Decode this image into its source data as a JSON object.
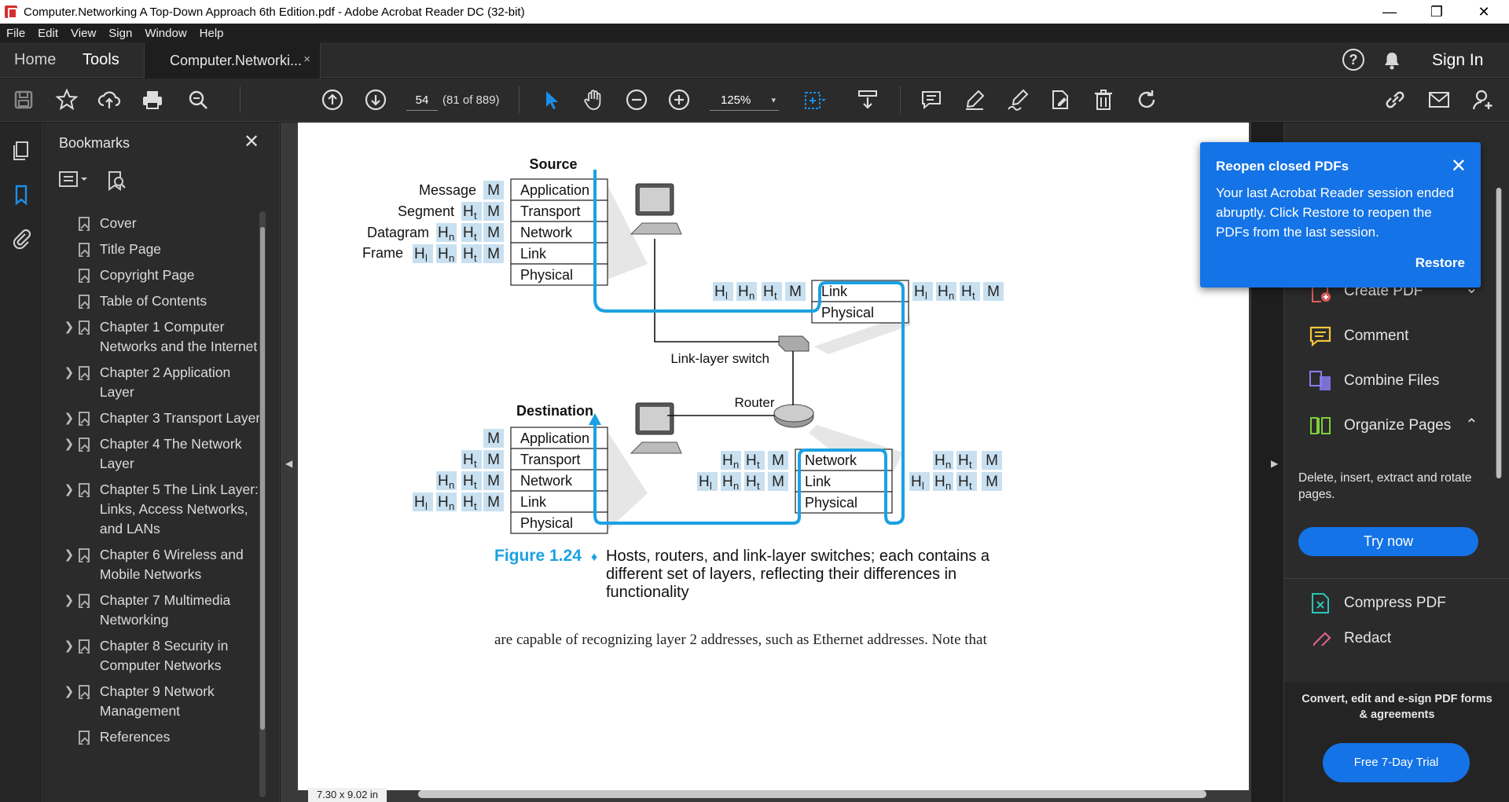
{
  "window": {
    "title": "Computer.Networking A Top-Down Approach 6th Edition.pdf - Adobe Acrobat Reader DC (32-bit)",
    "minimize": "—",
    "maximize": "❐",
    "close": "✕"
  },
  "menu": [
    "File",
    "Edit",
    "View",
    "Sign",
    "Window",
    "Help"
  ],
  "tabs": {
    "home": "Home",
    "tools": "Tools",
    "document": "Computer.Networki...",
    "close": "×"
  },
  "header": {
    "help": "?",
    "sign_in": "Sign In"
  },
  "toolbar": {
    "page_number": "54",
    "page_count": "(81 of 889)",
    "zoom": "125%",
    "zoom_caret": "▾"
  },
  "bookmarks": {
    "title": "Bookmarks",
    "close": "✕",
    "items": [
      {
        "label": "Cover",
        "expandable": false
      },
      {
        "label": "Title Page",
        "expandable": false
      },
      {
        "label": "Copyright Page",
        "expandable": false
      },
      {
        "label": "Table of Contents",
        "expandable": false
      },
      {
        "label": "Chapter 1 Computer Networks and the Internet",
        "expandable": true
      },
      {
        "label": "Chapter 2 Application Layer",
        "expandable": true
      },
      {
        "label": "Chapter 3 Transport Layer",
        "expandable": true
      },
      {
        "label": "Chapter 4 The Network Layer",
        "expandable": true
      },
      {
        "label": "Chapter 5 The Link Layer: Links, Access Networks, and LANs",
        "expandable": true
      },
      {
        "label": "Chapter 6 Wireless and Mobile Networks",
        "expandable": true
      },
      {
        "label": "Chapter 7 Multimedia Networking",
        "expandable": true
      },
      {
        "label": "Chapter 8 Security in Computer Networks",
        "expandable": true
      },
      {
        "label": "Chapter 9 Network Management",
        "expandable": true
      },
      {
        "label": "References",
        "expandable": false
      }
    ]
  },
  "document": {
    "figure": {
      "source": "Source",
      "destination": "Destination",
      "link_layer_switch": "Link-layer switch",
      "router": "Router",
      "row_labels": [
        "Message",
        "Segment",
        "Datagram",
        "Frame"
      ],
      "layers": [
        "Application",
        "Transport",
        "Network",
        "Link",
        "Physical"
      ],
      "switch_layers": [
        "Link",
        "Physical"
      ],
      "router_layers": [
        "Network",
        "Link",
        "Physical"
      ],
      "header_m": "M",
      "header_t": "t",
      "header_n": "n",
      "header_l": "l",
      "header_h": "H",
      "caption_label": "Figure 1.24",
      "caption_diamond": "♦",
      "caption_text": [
        "Hosts, routers, and link-layer switches; each contains a",
        "different set of layers, reflecting their differences in",
        "functionality"
      ]
    },
    "body_text_cut": "are capable of recognizing layer 2 addresses, such as Ethernet addresses. Note that",
    "page_size": "7.30 x 9.02 in"
  },
  "popup": {
    "title": "Reopen closed PDFs",
    "body": "Your last Acrobat Reader session ended abruptly. Click Restore to reopen the PDFs from the last session.",
    "close": "✕",
    "action": "Restore"
  },
  "right_pane": {
    "tools": [
      {
        "label": "Create PDF",
        "icon": "create-pdf-icon",
        "color": "#e25d5d"
      },
      {
        "label": "Comment",
        "icon": "comment-icon",
        "color": "#f0c53a"
      },
      {
        "label": "Combine Files",
        "icon": "combine-files-icon",
        "color": "#8a7cf0"
      },
      {
        "label": "Organize Pages",
        "icon": "organize-pages-icon",
        "color": "#7fce3a"
      },
      {
        "label": "Compress PDF",
        "icon": "compress-pdf-icon",
        "color": "#2ec4b6"
      },
      {
        "label": "Redact",
        "icon": "redact-icon",
        "color": "#e2668f"
      }
    ],
    "create_chevron": "⌄",
    "organize_chevron": "⌃",
    "organize_desc": "Delete, insert, extract and rotate pages.",
    "try_now": "Try now",
    "promo_text": "Convert, edit and e-sign PDF forms & agreements",
    "trial_button": "Free 7-Day Trial"
  },
  "colors": {
    "accent": "#1473e6",
    "figure_blue": "#1ba1e2",
    "header_cell": "#c8e0f0"
  }
}
